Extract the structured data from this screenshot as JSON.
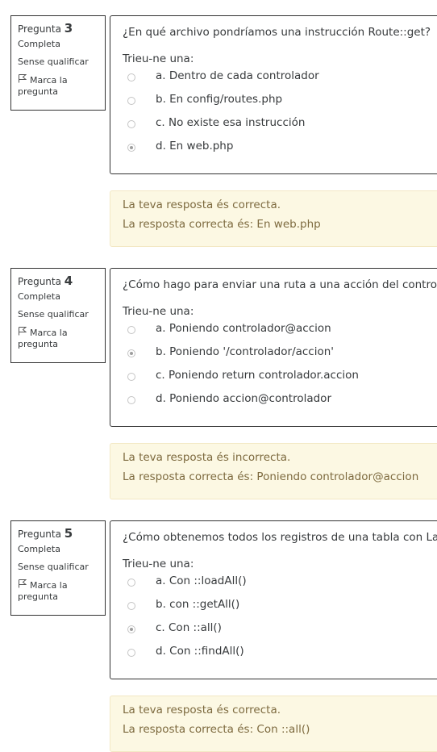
{
  "questions": [
    {
      "label": "Pregunta",
      "number": "3",
      "state": "Completa",
      "grade": "Sense qualificar",
      "flag_line1": "Marca la",
      "flag_line2": "pregunta",
      "text": "¿En qué archivo pondríamos una instrucción Route::get?",
      "prompt": "Trieu-ne una:",
      "options": [
        {
          "label": "a. Dentro de cada controlador",
          "checked": false
        },
        {
          "label": "b. En config/routes.php",
          "checked": false
        },
        {
          "label": "c. No existe esa instrucción",
          "checked": false
        },
        {
          "label": "d. En web.php",
          "checked": true
        }
      ],
      "feedback_status": "La teva resposta és correcta.",
      "feedback_answer": "La resposta correcta és: En web.php"
    },
    {
      "label": "Pregunta",
      "number": "4",
      "state": "Completa",
      "grade": "Sense qualificar",
      "flag_line1": "Marca la",
      "flag_line2": "pregunta",
      "text": "¿Cómo hago para enviar una ruta a una acción del controlador?",
      "prompt": "Trieu-ne una:",
      "options": [
        {
          "label": "a. Poniendo controlador@accion",
          "checked": false
        },
        {
          "label": "b. Poniendo '/controlador/accion'",
          "checked": true
        },
        {
          "label": "c. Poniendo return controlador.accion",
          "checked": false
        },
        {
          "label": "d. Poniendo accion@controlador",
          "checked": false
        }
      ],
      "feedback_status": "La teva resposta és incorrecta.",
      "feedback_answer": "La resposta correcta és: Poniendo controlador@accion"
    },
    {
      "label": "Pregunta",
      "number": "5",
      "state": "Completa",
      "grade": "Sense qualificar",
      "flag_line1": "Marca la",
      "flag_line2": "pregunta",
      "text": "¿Cómo obtenemos todos los registros de una tabla con Laravel?",
      "prompt": "Trieu-ne una:",
      "options": [
        {
          "label": "a. Con ::loadAll()",
          "checked": false
        },
        {
          "label": "b. con ::getAll()",
          "checked": false
        },
        {
          "label": "c. Con ::all()",
          "checked": true
        },
        {
          "label": "d. Con ::findAll()",
          "checked": false
        }
      ],
      "feedback_status": "La teva resposta és correcta.",
      "feedback_answer": "La resposta correcta és: Con ::all()"
    }
  ]
}
